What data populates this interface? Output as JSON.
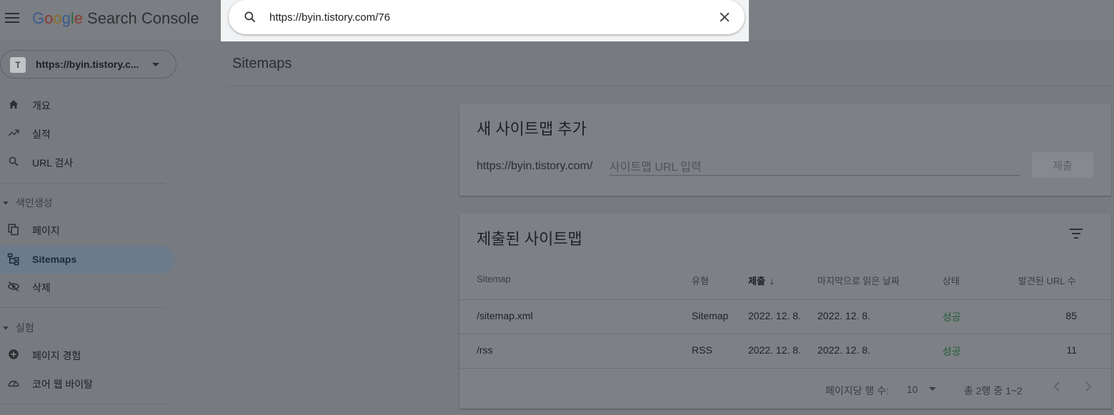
{
  "header": {
    "logo": {
      "G": "G",
      "o1": "o",
      "o2": "o",
      "g": "g",
      "l": "l",
      "e": "e",
      "product": "Search Console"
    },
    "search": {
      "value": "https://byin.tistory.com/76",
      "placeholder": ""
    }
  },
  "sidebar": {
    "property": {
      "label": "https://byin.tistory.c...",
      "icon": "T"
    },
    "items": [
      {
        "label": "개요",
        "icon": "home-icon"
      },
      {
        "label": "실적",
        "icon": "trending-up-icon"
      },
      {
        "label": "URL 검사",
        "icon": "search-icon"
      }
    ],
    "sections": [
      {
        "label": "색인생성",
        "items": [
          {
            "label": "페이지",
            "icon": "pages-icon"
          },
          {
            "label": "Sitemaps",
            "icon": "sitemap-icon",
            "active": true
          },
          {
            "label": "삭제",
            "icon": "visibility-off-icon"
          }
        ]
      },
      {
        "label": "실험",
        "items": [
          {
            "label": "페이지 경험",
            "icon": "add-circle-icon"
          },
          {
            "label": "코어 웹 바이탈",
            "icon": "speed-icon"
          }
        ]
      }
    ]
  },
  "main": {
    "title": "Sitemaps",
    "add_card": {
      "title": "새 사이트맵 추가",
      "base_url": "https://byin.tistory.com/",
      "input_placeholder": "사이트맵 URL 입력",
      "submit_label": "제출"
    },
    "list_card": {
      "title": "제출된 사이트맵",
      "columns": [
        "Sitemap",
        "유형",
        "제출",
        "마지막으로 읽은 날짜",
        "상태",
        "발견된 URL 수"
      ],
      "rows": [
        {
          "sitemap": "/sitemap.xml",
          "type": "Sitemap",
          "submitted": "2022. 12. 8.",
          "last_read": "2022. 12. 8.",
          "status": "성공",
          "urls": "85"
        },
        {
          "sitemap": "/rss",
          "type": "RSS",
          "submitted": "2022. 12. 8.",
          "last_read": "2022. 12. 8.",
          "status": "성공",
          "urls": "11"
        }
      ],
      "pager": {
        "rows_label": "페이지당 행 수:",
        "rows_value": "10",
        "range": "총 2행 중 1~2"
      }
    }
  },
  "colors": {
    "success": "#1e8e3e",
    "active_nav": "#e8f0fe",
    "overlay": "rgba(0,0,0,0.5)"
  }
}
